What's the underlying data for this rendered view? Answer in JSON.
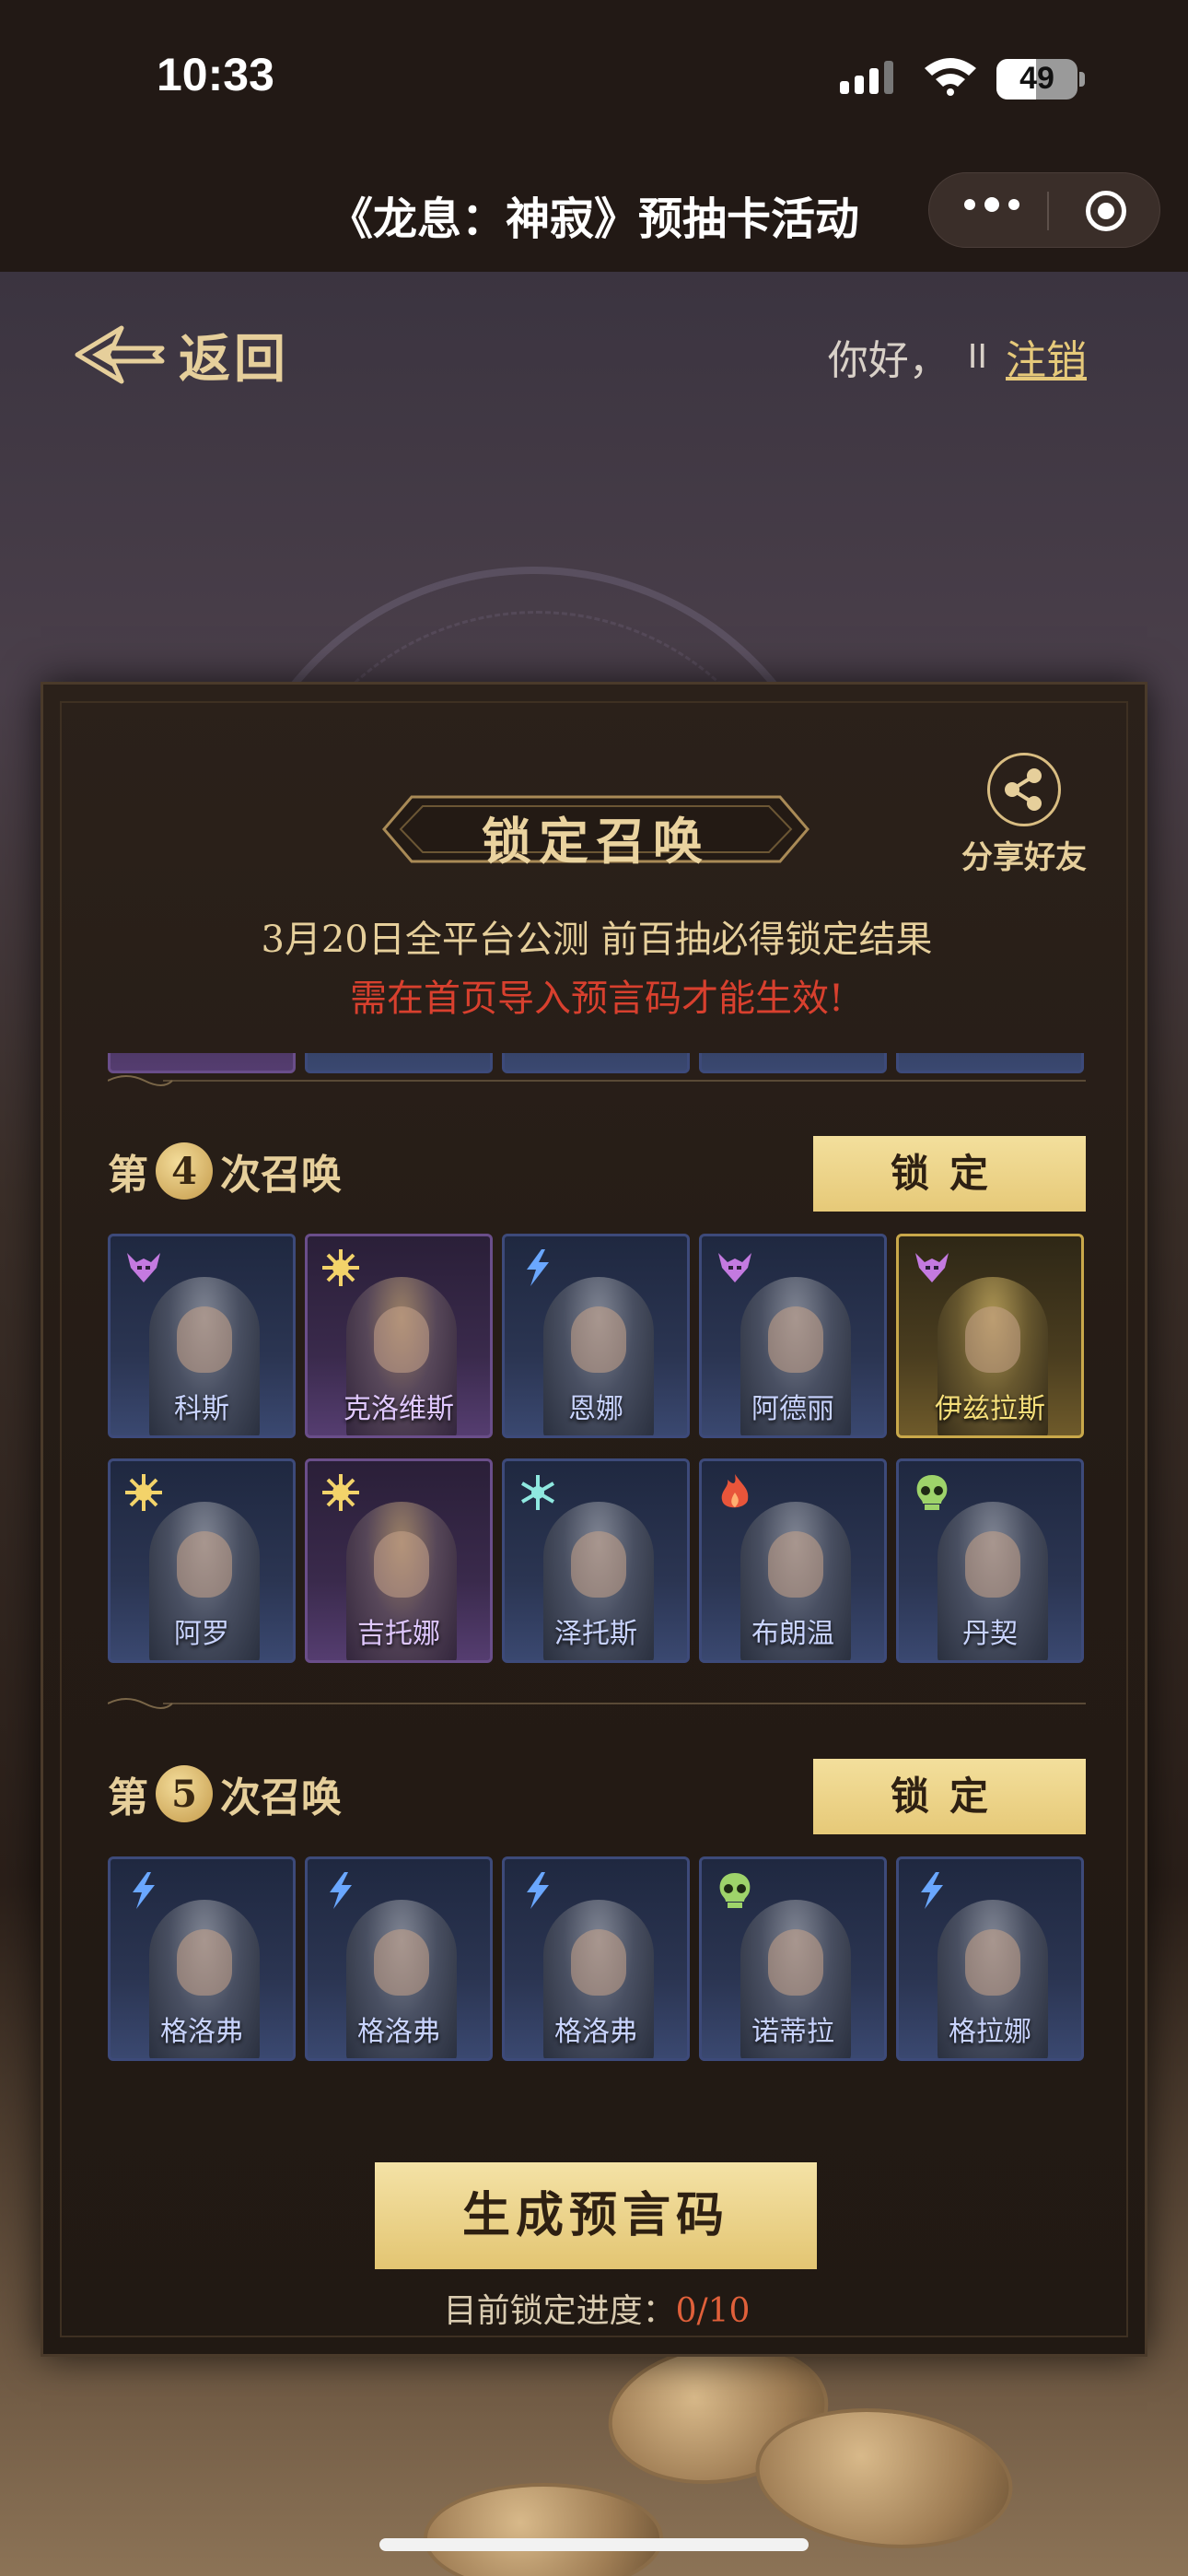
{
  "status_bar": {
    "time": "10:33",
    "battery": "49",
    "battery_level": 0.49
  },
  "title_bar": {
    "title": "《龙息：神寂》预抽卡活动",
    "more_icon": "more-dots-icon",
    "close_icon": "target-close-icon"
  },
  "top_nav": {
    "back_label": "返回",
    "greeting": "你好，",
    "user_name": "II",
    "logout": "注销"
  },
  "panel": {
    "title": "锁定召唤",
    "share_label": "分享好友",
    "notice_line1": "3月20日全平台公测 前百抽必得锁定结果",
    "notice_line2": "需在首页导入预言码才能生效!",
    "rounds": [
      {
        "prefix": "第",
        "number": "4",
        "suffix": "次召唤",
        "lock_label": "锁定",
        "rows": [
          [
            {
              "name": "科斯",
              "element": "demon-icon",
              "frame": "blue"
            },
            {
              "name": "克洛维斯",
              "element": "light-icon",
              "frame": "purple"
            },
            {
              "name": "恩娜",
              "element": "lightning-icon",
              "frame": "blue"
            },
            {
              "name": "阿德丽",
              "element": "demon-icon",
              "frame": "blue"
            },
            {
              "name": "伊兹拉斯",
              "element": "demon-icon",
              "frame": "gold"
            }
          ],
          [
            {
              "name": "阿罗",
              "element": "light-icon",
              "frame": "blue"
            },
            {
              "name": "吉托娜",
              "element": "light-icon",
              "frame": "purple"
            },
            {
              "name": "泽托斯",
              "element": "frost-icon",
              "frame": "blue"
            },
            {
              "name": "布朗温",
              "element": "fire-icon",
              "frame": "blue"
            },
            {
              "name": "丹契",
              "element": "skull-icon",
              "frame": "blue"
            }
          ]
        ]
      },
      {
        "prefix": "第",
        "number": "5",
        "suffix": "次召唤",
        "lock_label": "锁定",
        "rows": [
          [
            {
              "name": "格洛弗",
              "element": "lightning-icon",
              "frame": "blue"
            },
            {
              "name": "格洛弗",
              "element": "lightning-icon",
              "frame": "blue"
            },
            {
              "name": "格洛弗",
              "element": "lightning-icon",
              "frame": "blue"
            },
            {
              "name": "诺蒂拉",
              "element": "skull-icon",
              "frame": "blue"
            },
            {
              "name": "格拉娜",
              "element": "lightning-icon",
              "frame": "blue"
            }
          ]
        ]
      }
    ],
    "generate_label": "生成预言码",
    "progress_label": "目前锁定进度：",
    "progress_value": "0/10"
  },
  "colors": {
    "gold_text": "#e6cf9b",
    "warning_red": "#d8402e",
    "button_gold": "#f3df9c",
    "progress_orange": "#e0603a"
  }
}
